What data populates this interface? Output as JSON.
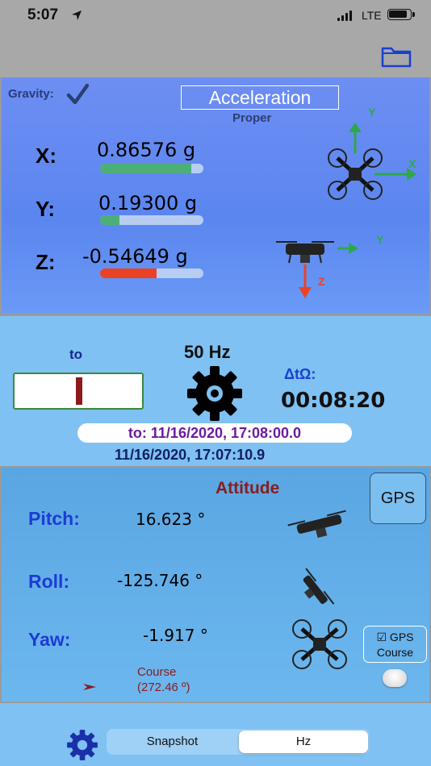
{
  "status_bar": {
    "time": "5:07",
    "network": "LTE"
  },
  "acceleration": {
    "gravity_label": "Gravity:",
    "title": "Acceleration",
    "subtitle": "Proper",
    "axes": [
      {
        "label": "X:",
        "value": "0.86576 g",
        "bar_fraction": 0.88,
        "bar_color": "#4caf78"
      },
      {
        "label": "Y:",
        "value": "0.19300 g",
        "bar_fraction": 0.19,
        "bar_color": "#4caf78"
      },
      {
        "label": "Z:",
        "value": "-0.54649 g",
        "bar_fraction": 0.55,
        "bar_color": "#ec4224"
      }
    ],
    "diagram_axis_labels": {
      "top_x": "X",
      "top_y": "Y",
      "side_y": "Y",
      "side_z": "Z"
    }
  },
  "control": {
    "to_label": "to",
    "rate": "50 Hz",
    "delta_label": "ΔtΩ:",
    "delta_value": "00:08:20",
    "to_timestamp": "to: 11/16/2020, 17:08:00.0",
    "current_timestamp": "11/16/2020, 17:07:10.9"
  },
  "attitude": {
    "title": "Attitude",
    "gps_button": "GPS",
    "rows": [
      {
        "label": "Pitch:",
        "value": "16.623 °"
      },
      {
        "label": "Roll:",
        "value": "-125.746 °"
      },
      {
        "label": "Yaw:",
        "value": "-1.917 °"
      }
    ],
    "gps_course_line1": "☑ GPS",
    "gps_course_line2": "Course",
    "course_label": "Course",
    "course_value": "(272.46 º)"
  },
  "bottom_bar": {
    "segments": [
      "Snapshot",
      "Hz"
    ],
    "selected": "Hz"
  },
  "colors": {
    "accel_panel": "#5b86ef",
    "mid_panel": "#7fc1f2",
    "attitude_panel": "#5aa6e2"
  }
}
